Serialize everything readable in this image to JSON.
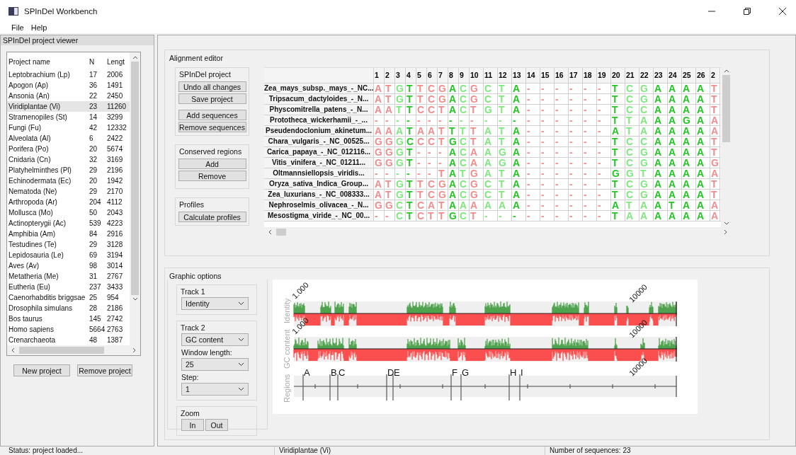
{
  "window": {
    "title": "SPInDel Workbench"
  },
  "menu": [
    "File",
    "Help"
  ],
  "project_viewer": {
    "title": "SPInDel project viewer",
    "columns": [
      "Project name",
      "N",
      "Lengt"
    ],
    "rows": [
      {
        "name": "Leptobrachium (Lp)",
        "n": "17",
        "length": "2006",
        "selected": false
      },
      {
        "name": "Apogon (Ap)",
        "n": "36",
        "length": "1491",
        "selected": false
      },
      {
        "name": "Ansonia (An)",
        "n": "22",
        "length": "2450",
        "selected": false
      },
      {
        "name": "Viridiplantae (Vi)",
        "n": "23",
        "length": "11260",
        "selected": true
      },
      {
        "name": "Stramenopiles (St)",
        "n": "14",
        "length": "3299",
        "selected": false
      },
      {
        "name": "Fungi (Fu)",
        "n": "42",
        "length": "12332",
        "selected": false
      },
      {
        "name": "Alveolata (Al)",
        "n": "6",
        "length": "2422",
        "selected": false
      },
      {
        "name": "Porifera (Po)",
        "n": "20",
        "length": "5674",
        "selected": false
      },
      {
        "name": "Cnidaria (Cn)",
        "n": "32",
        "length": "3169",
        "selected": false
      },
      {
        "name": "Platyhelminthes (Pl)",
        "n": "29",
        "length": "2196",
        "selected": false
      },
      {
        "name": "Echinodermata (Ec)",
        "n": "20",
        "length": "1942",
        "selected": false
      },
      {
        "name": "Nematoda (Ne)",
        "n": "29",
        "length": "2170",
        "selected": false
      },
      {
        "name": "Arthropoda (Ar)",
        "n": "204",
        "length": "4112",
        "selected": false
      },
      {
        "name": "Mollusca (Mo)",
        "n": "50",
        "length": "2043",
        "selected": false
      },
      {
        "name": "Actinopterygii (Ac)",
        "n": "539",
        "length": "4223",
        "selected": false
      },
      {
        "name": "Amphibia (Am)",
        "n": "84",
        "length": "2916",
        "selected": false
      },
      {
        "name": "Testudines (Te)",
        "n": "29",
        "length": "3128",
        "selected": false
      },
      {
        "name": "Lepidosauria (Le)",
        "n": "69",
        "length": "3194",
        "selected": false
      },
      {
        "name": "Aves (Av)",
        "n": "98",
        "length": "3014",
        "selected": false
      },
      {
        "name": "Metatheria (Me)",
        "n": "31",
        "length": "2767",
        "selected": false
      },
      {
        "name": "Eutheria (Eu)",
        "n": "237",
        "length": "3433",
        "selected": false
      },
      {
        "name": "Caenorhabditis briggsae",
        "n": "25",
        "length": "954",
        "selected": false
      },
      {
        "name": "Drosophila simulans",
        "n": "28",
        "length": "2186",
        "selected": false
      },
      {
        "name": "Bos taurus",
        "n": "145",
        "length": "2742",
        "selected": false
      },
      {
        "name": "Homo sapiens",
        "n": "5664",
        "length": "2763",
        "selected": false
      },
      {
        "name": "Crenarchaeota",
        "n": "48",
        "length": "1387",
        "selected": false
      }
    ],
    "buttons": [
      "New project",
      "Remove project"
    ]
  },
  "alignment_editor": {
    "title": "Alignment editor",
    "groups": [
      {
        "title": "SPInDel project",
        "buttons": [
          "Undo all changes",
          "Save project",
          "Add sequences",
          "Remove sequences"
        ]
      },
      {
        "title": "Conserved regions",
        "buttons": [
          "Add",
          "Remove"
        ]
      },
      {
        "title": "Profiles",
        "buttons": [
          "Calculate profiles"
        ]
      }
    ],
    "columns": [
      {
        "label": "1",
        "color": "#f28c8c"
      },
      {
        "label": "2",
        "color": "#f28c8c"
      },
      {
        "label": "3",
        "color": "#7ee87e"
      },
      {
        "label": "4",
        "color": "#22c622"
      },
      {
        "label": "5",
        "color": "#f28c8c"
      },
      {
        "label": "6",
        "color": "#f28c8c"
      },
      {
        "label": "7",
        "color": "#f28c8c"
      },
      {
        "label": "8",
        "color": "#22c622"
      },
      {
        "label": "9",
        "color": "#7ee87e"
      },
      {
        "label": "10",
        "color": "#f28c8c"
      },
      {
        "label": "11",
        "color": "#7ee87e"
      },
      {
        "label": "12",
        "color": "#7ee87e"
      },
      {
        "label": "13",
        "color": "#22c622"
      },
      {
        "label": "14",
        "color": "#f28c8c"
      },
      {
        "label": "15",
        "color": "#f28c8c"
      },
      {
        "label": "16",
        "color": "#f28c8c"
      },
      {
        "label": "17",
        "color": "#f28c8c"
      },
      {
        "label": "18",
        "color": "#f28c8c"
      },
      {
        "label": "19",
        "color": "#f28c8c"
      },
      {
        "label": "20",
        "color": "#22c622"
      },
      {
        "label": "21",
        "color": "#7ee87e"
      },
      {
        "label": "22",
        "color": "#7ee87e"
      },
      {
        "label": "23",
        "color": "#22c622"
      },
      {
        "label": "24",
        "color": "#22c622"
      },
      {
        "label": "25",
        "color": "#22c622"
      },
      {
        "label": "26",
        "color": "#22c622"
      },
      {
        "label": "2",
        "color": "#f28c8c"
      }
    ],
    "rows": [
      {
        "name": "Zea_mays_subsp._mays_-_NC...",
        "bases": [
          "A",
          "T",
          "G",
          "T",
          "T",
          "C",
          "G",
          "A",
          "C",
          "G",
          "C",
          "T",
          "A",
          "-",
          "-",
          "-",
          "-",
          "-",
          "-",
          "T",
          "C",
          "G",
          "A",
          "A",
          "A",
          "A",
          "T"
        ]
      },
      {
        "name": "Tripsacum_dactyloides_-_N...",
        "bases": [
          "A",
          "T",
          "G",
          "T",
          "T",
          "C",
          "G",
          "A",
          "C",
          "G",
          "C",
          "T",
          "A",
          "-",
          "-",
          "-",
          "-",
          "-",
          "-",
          "T",
          "C",
          "G",
          "A",
          "A",
          "A",
          "A",
          "T"
        ]
      },
      {
        "name": "Physcomitrella_patens_-_N...",
        "bases": [
          "A",
          "A",
          "T",
          "T",
          "C",
          "C",
          "T",
          "A",
          "C",
          "T",
          "G",
          "T",
          "A",
          "-",
          "-",
          "-",
          "-",
          "-",
          "-",
          "T",
          "C",
          "C",
          "A",
          "A",
          "A",
          "A",
          "T"
        ]
      },
      {
        "name": "Prototheca_wickerhamii_-_...",
        "bases": [
          "-",
          "-",
          "-",
          "-",
          "-",
          "-",
          "-",
          "-",
          "-",
          "-",
          "-",
          "-",
          "-",
          "-",
          "-",
          "-",
          "-",
          "-",
          "-",
          "T",
          "T",
          "A",
          "A",
          "A",
          "G",
          "A",
          "A"
        ]
      },
      {
        "name": "Pseudendoclonium_akinetum...",
        "bases": [
          "A",
          "A",
          "A",
          "T",
          "A",
          "A",
          "T",
          "T",
          "T",
          "T",
          "A",
          "T",
          "A",
          "-",
          "-",
          "-",
          "-",
          "-",
          "-",
          "A",
          "T",
          "A",
          "A",
          "A",
          "A",
          "A",
          "A"
        ]
      },
      {
        "name": "Chara_vulgaris_-_NC_00525...",
        "bases": [
          "G",
          "G",
          "G",
          "C",
          "C",
          "C",
          "T",
          "G",
          "C",
          "T",
          "A",
          "T",
          "A",
          "-",
          "-",
          "-",
          "-",
          "-",
          "-",
          "T",
          "C",
          "C",
          "A",
          "A",
          "A",
          "A",
          "T"
        ]
      },
      {
        "name": "Carica_papaya_-_NC_012116...",
        "bases": [
          "G",
          "G",
          "G",
          "T",
          "-",
          "-",
          "-",
          "A",
          "C",
          "A",
          "A",
          "G",
          "A",
          "-",
          "-",
          "-",
          "-",
          "-",
          "-",
          "T",
          "C",
          "G",
          "A",
          "A",
          "A",
          "A",
          "T"
        ]
      },
      {
        "name": "Vitis_vinifera_-_NC_01211...",
        "bases": [
          "G",
          "G",
          "G",
          "T",
          "-",
          "-",
          "-",
          "A",
          "C",
          "A",
          "A",
          "G",
          "A",
          "-",
          "-",
          "-",
          "-",
          "-",
          "-",
          "T",
          "C",
          "G",
          "A",
          "A",
          "A",
          "A",
          "G"
        ]
      },
      {
        "name": "Oltmannsiellopsis_viridis...",
        "bases": [
          "-",
          "-",
          "-",
          "-",
          "-",
          "-",
          "T",
          "A",
          "T",
          "G",
          "A",
          "T",
          "A",
          "-",
          "-",
          "-",
          "-",
          "-",
          "-",
          "G",
          "G",
          "T",
          "A",
          "A",
          "A",
          "A",
          "A"
        ]
      },
      {
        "name": "Oryza_sativa_Indica_Group...",
        "bases": [
          "A",
          "T",
          "G",
          "T",
          "T",
          "C",
          "G",
          "A",
          "C",
          "G",
          "C",
          "T",
          "A",
          "-",
          "-",
          "-",
          "-",
          "-",
          "-",
          "T",
          "C",
          "G",
          "A",
          "A",
          "A",
          "A",
          "T"
        ]
      },
      {
        "name": "Zea_luxurians_-_NC_008333...",
        "bases": [
          "A",
          "T",
          "G",
          "T",
          "T",
          "C",
          "G",
          "A",
          "C",
          "G",
          "C",
          "T",
          "A",
          "-",
          "-",
          "-",
          "-",
          "-",
          "-",
          "T",
          "C",
          "G",
          "A",
          "A",
          "A",
          "A",
          "T"
        ]
      },
      {
        "name": "Nephroselmis_olivacea_-_N...",
        "bases": [
          "G",
          "G",
          "C",
          "T",
          "C",
          "A",
          "T",
          "A",
          "A",
          "A",
          "A",
          "A",
          "A",
          "-",
          "-",
          "-",
          "-",
          "-",
          "-",
          "A",
          "T",
          "A",
          "A",
          "T",
          "A",
          "A",
          "A"
        ]
      },
      {
        "name": "Mesostigma_viride_-_NC_00...",
        "bases": [
          "-",
          "-",
          "C",
          "T",
          "C",
          "T",
          "T",
          "G",
          "C",
          "T",
          "-",
          "-",
          "-",
          "-",
          "-",
          "-",
          "-",
          "-",
          "-",
          "T",
          "A",
          "A",
          "A",
          "A",
          "A",
          "A",
          "A"
        ]
      }
    ]
  },
  "graphic_options": {
    "title": "Graphic options",
    "track1": {
      "title": "Track 1",
      "value": "Identity"
    },
    "track2": {
      "title": "Track 2",
      "value": "GC content",
      "window_length_label": "Window length:",
      "window_length": "25",
      "step_label": "Step:",
      "step": "1"
    },
    "zoom": {
      "title": "Zoom",
      "buttons": [
        "In",
        "Out"
      ]
    }
  },
  "plot": {
    "track_labels": [
      "Identity",
      "GC content",
      "Regions"
    ],
    "max_labels": [
      "1.000",
      "1.000"
    ],
    "position_labels": [
      "10000",
      "10000",
      "10000"
    ],
    "regions": [
      "A",
      "B",
      "C",
      "D",
      "E",
      "F",
      "G",
      "H",
      "I"
    ]
  },
  "status_bar": [
    "Status: project loaded...",
    "Viridiplantae (Vi)",
    "Number of sequences: 23"
  ]
}
